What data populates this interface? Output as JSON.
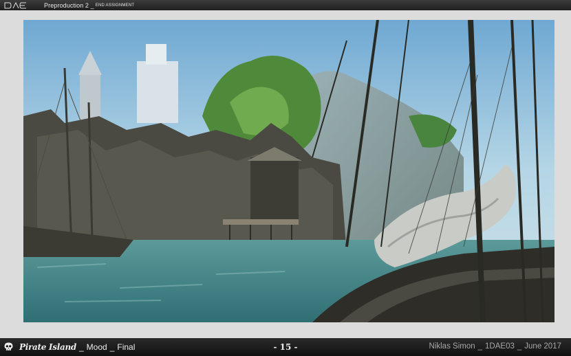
{
  "header": {
    "logo_text": "DAE",
    "title": "Preproduction 2 _",
    "subtitle": "END ASSIGNMENT"
  },
  "artwork": {
    "icon": "pirate-harbor-painting",
    "palette": {
      "sky": "#a9cfe3",
      "sky_top": "#7fb3d6",
      "water": "#4f8f92",
      "wood": "#3b3a33",
      "foliage": "#4e8a3a",
      "sail": "#c9ccc6"
    }
  },
  "footer": {
    "skull_icon": "skull-icon",
    "game_name": "Pirate Island",
    "separator": "_",
    "mood": "Mood",
    "final": "Final",
    "page_number": "- 15 -",
    "author": "Niklas Simon",
    "class_code": "1DAE03",
    "date": "June 2017"
  }
}
